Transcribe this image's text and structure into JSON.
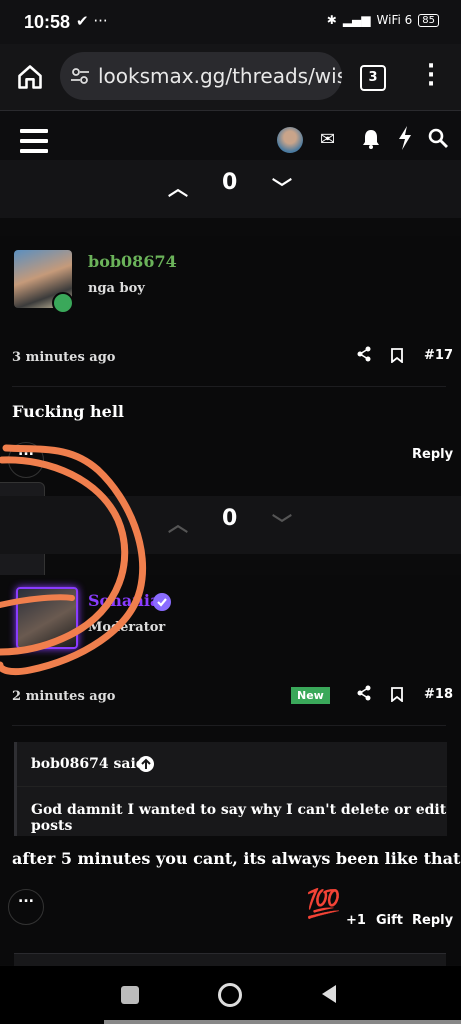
{
  "status_bar": {
    "time": "10:58",
    "icons": "✔ ···",
    "wifi": "WiFi 6",
    "battery": "85"
  },
  "browser": {
    "url": "looksmax.gg/threads/wisd",
    "tab_count": "3"
  },
  "vote_top": {
    "score": "0"
  },
  "post17": {
    "username": "bob08674",
    "user_title": "nga boy",
    "time": "3 minutes ago",
    "number": "#17",
    "body": "Fucking hell",
    "reply": "Reply",
    "more": "..."
  },
  "vote_mid": {
    "score": "0"
  },
  "post18": {
    "username": "Sohaniae",
    "user_title": "Moderator",
    "time": "2 minutes ago",
    "badge": "New",
    "number": "#18",
    "quote_author": "bob08674 said:",
    "quote_text": "God damnit I wanted to say why I can't delete or edit posts",
    "body": "after 5 minutes you cant, its always been like that",
    "reaction_emoji": "💯",
    "reaction_count": "+1",
    "gift": "Gift",
    "reply": "Reply",
    "more": "..."
  },
  "colors": {
    "username_green": "#6bb35a",
    "moderator_purple": "#8a3cff",
    "annotation_orange": "#f07f4d"
  }
}
